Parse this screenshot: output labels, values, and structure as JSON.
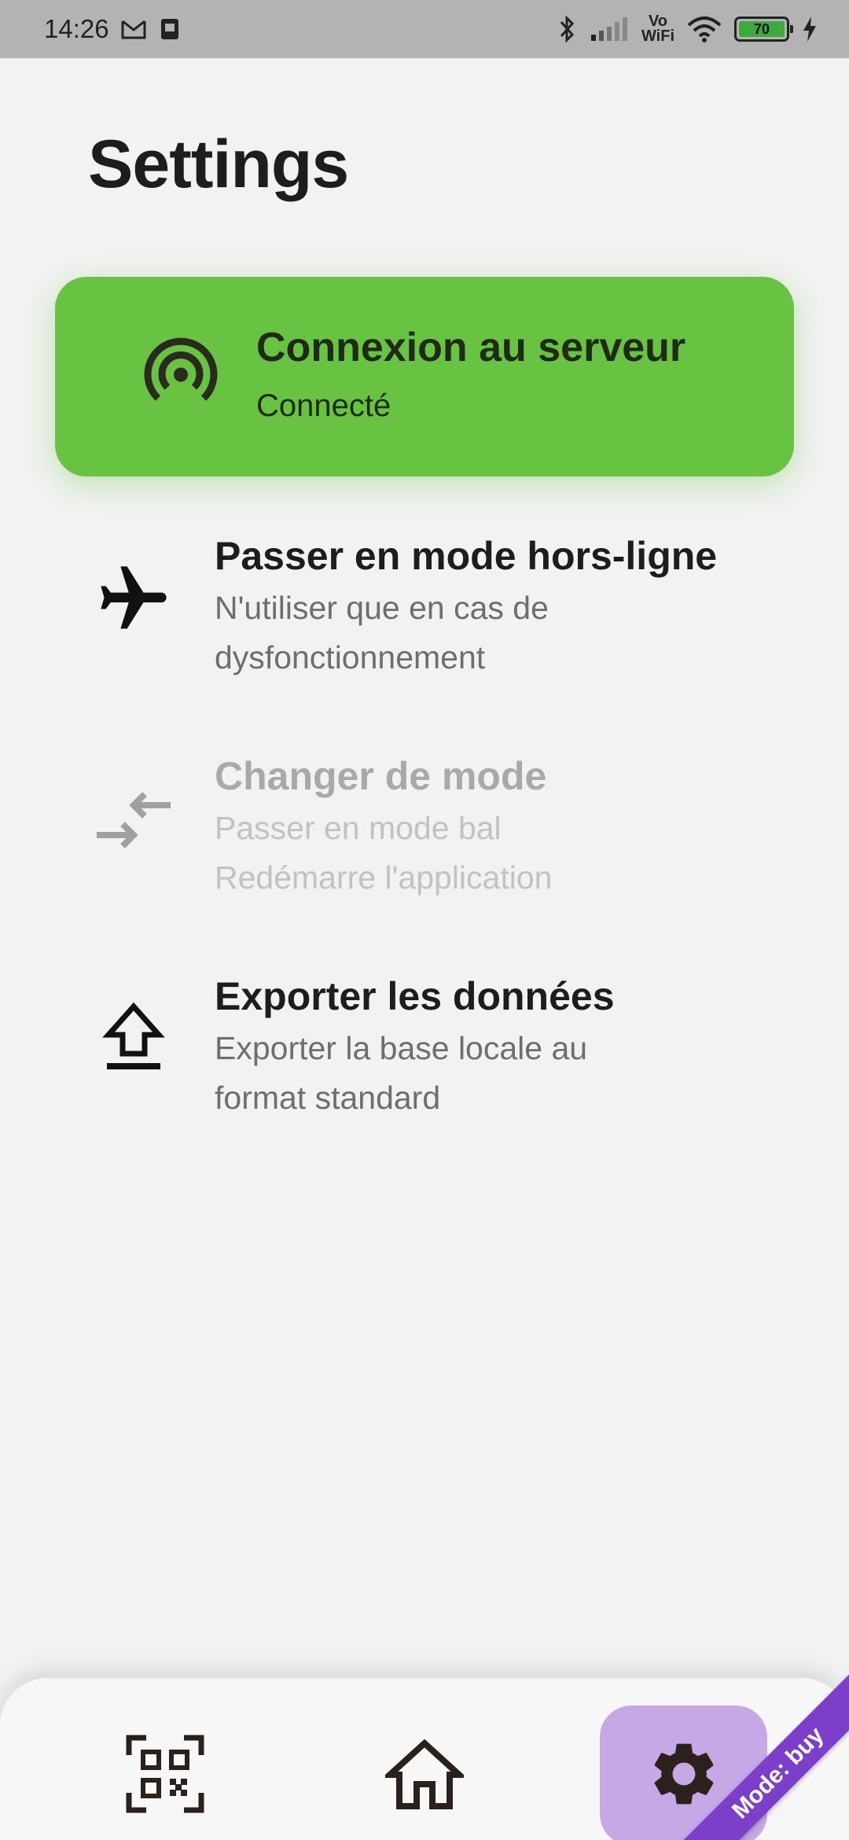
{
  "status_bar": {
    "time": "14:26",
    "battery_level": "70",
    "network_label_top": "Vo",
    "network_label_bottom": "WiFi",
    "icons": [
      "gmail-icon",
      "sim-card-icon",
      "bluetooth-icon",
      "signal-icon",
      "wifi-icon",
      "battery-icon",
      "charging-icon"
    ]
  },
  "page": {
    "title": "Settings"
  },
  "server_card": {
    "title": "Connexion au serveur",
    "status": "Connecté",
    "icon": "server-connection-icon",
    "color": "#69c342"
  },
  "items": [
    {
      "title": "Passer en mode hors-ligne",
      "subtitle_line1": "N'utiliser que en cas de",
      "subtitle_line2": "dysfonctionnement",
      "icon": "airplane-icon",
      "enabled": true
    },
    {
      "title": "Changer de mode",
      "subtitle_line1": "Passer en mode bal",
      "subtitle_line2": "Redémarre l'application",
      "icon": "switch-arrows-icon",
      "enabled": false
    },
    {
      "title": "Exporter les données",
      "subtitle_line1": "Exporter la base locale au",
      "subtitle_line2": "format standard",
      "icon": "upload-icon",
      "enabled": true
    }
  ],
  "bottom_nav": {
    "items": [
      "qr-scan-icon",
      "home-icon",
      "gear-icon"
    ],
    "active": "gear-icon",
    "active_color": "#c6a8e6"
  },
  "mode_ribbon": {
    "label": "Mode: buy",
    "color": "#7c3fc9"
  }
}
